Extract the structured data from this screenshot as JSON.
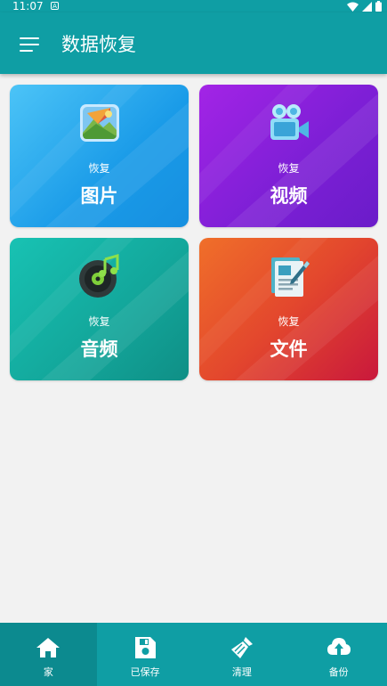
{
  "status_bar": {
    "time": "11:07",
    "notification_letter": "A"
  },
  "app_bar": {
    "title": "数据恢复",
    "menu_icon": "hamburger-menu-icon"
  },
  "cards": [
    {
      "id": "images",
      "icon": "image-gallery-icon",
      "subtitle": "恢复",
      "title": "图片"
    },
    {
      "id": "video",
      "icon": "video-camera-icon",
      "subtitle": "恢复",
      "title": "视频"
    },
    {
      "id": "audio",
      "icon": "music-disc-icon",
      "subtitle": "恢复",
      "title": "音频"
    },
    {
      "id": "files",
      "icon": "document-edit-icon",
      "subtitle": "恢复",
      "title": "文件"
    }
  ],
  "bottom_nav": [
    {
      "label": "家",
      "icon": "home-icon",
      "active": true
    },
    {
      "label": "已保存",
      "icon": "save-icon",
      "active": false
    },
    {
      "label": "清理",
      "icon": "broom-icon",
      "active": false
    },
    {
      "label": "备份",
      "icon": "cloud-upload-icon",
      "active": false
    }
  ],
  "colors": {
    "primary": "#0f9ea4",
    "primary_dark": "#0c8a8f",
    "background": "#f2f2f2"
  }
}
